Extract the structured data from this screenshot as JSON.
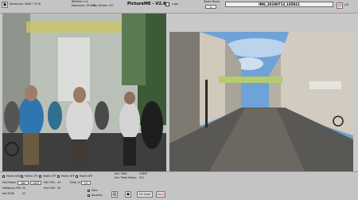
{
  "window": {
    "title": "PictureME - V2.6"
  },
  "top": {
    "dimensions_label": "Dimension: 2848 * 2136",
    "bitdepth_label": "Bittiefen: 4 b",
    "size_label": "Datensize: 18 MiPx",
    "colors_label": "Anz.Farben: 321",
    "lupe_label": "Lupe",
    "zoom_label": "Zoom Mauss",
    "zoom_value": "4",
    "filename": "IMG_20190713_185921",
    "lr_label": "L/R"
  },
  "status": {
    "matrix_items": [
      "Matrix B/W",
      "Matrix 1FF",
      "Matrix 3FF",
      "Matrix 4FF",
      "Matrix 8FF"
    ],
    "anz_pixel_label": "Anz. Pixel:",
    "anz_pixel_value": "22809",
    "anz_farben_label": "Anz. Peak Farben:",
    "anz_farben_value": "321",
    "pos_label": "Pos Farben:",
    "pos_x": "180",
    "pos_y": "1423",
    "hell_label": "Hell HSV:",
    "hell_value": "44",
    "helligkeit_label": "Hell RGB:",
    "helligkeit_value": "52",
    "sat_label": "Sattigung HSV:",
    "sat_value": "34",
    "hue_label": "Hue HSV:",
    "hue_value": "45",
    "entw_label": "Entw. nr:",
    "entw_value": "23",
    "filter_label": "Filter",
    "ansehen_label": "Ansehen",
    "fix_label": "Fix Used",
    "abort_label": "Abort"
  },
  "colors": {
    "accent": "#c02020",
    "bg": "#c8c8c8"
  }
}
